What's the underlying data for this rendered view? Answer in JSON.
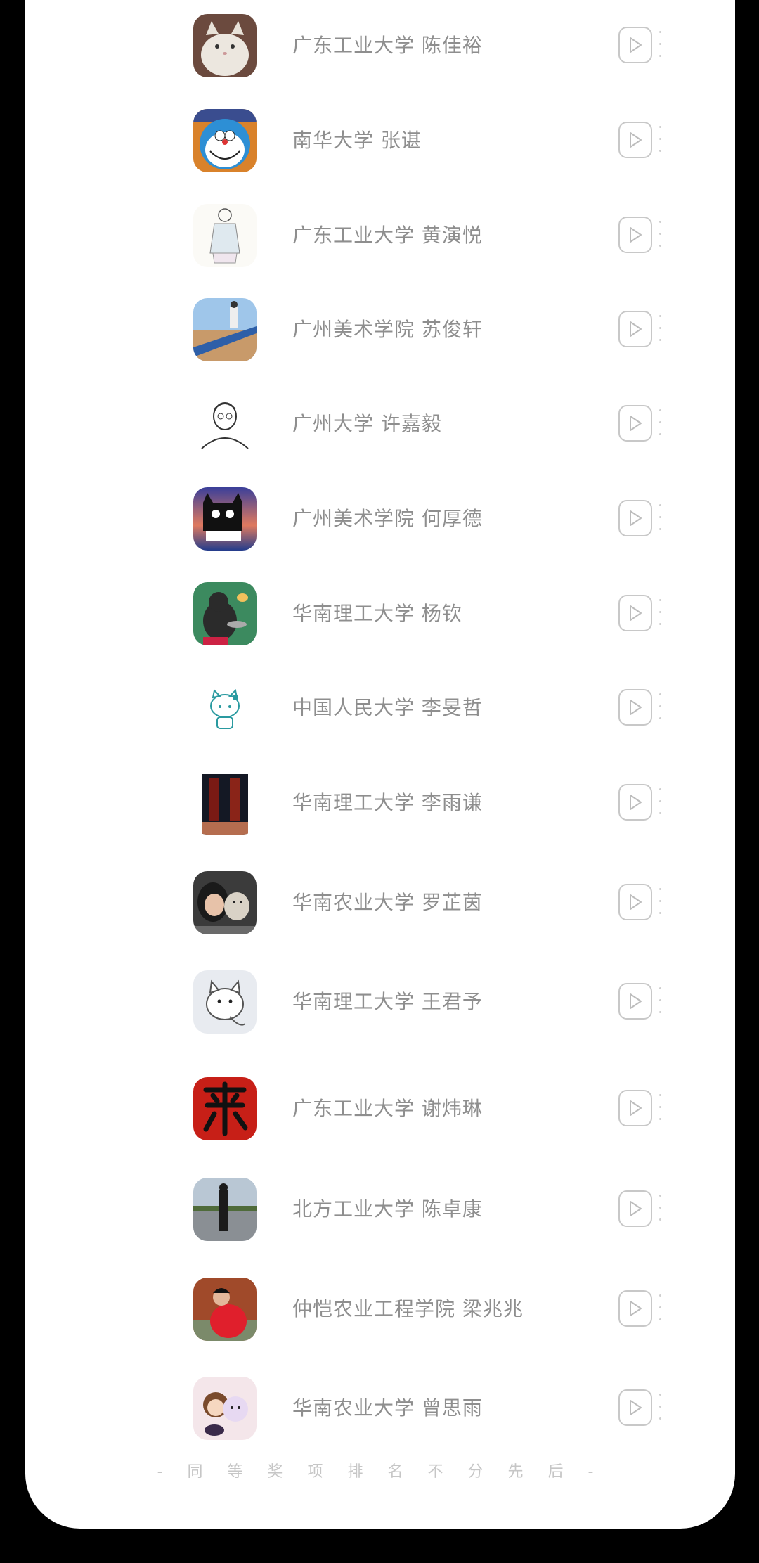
{
  "list": [
    {
      "name": "广东工业大学 陈佳裕",
      "avatar": "avatar-cat"
    },
    {
      "name": "南华大学 张谌",
      "avatar": "avatar-doraemon"
    },
    {
      "name": "广东工业大学 黄演悦",
      "avatar": "avatar-sketch-girl"
    },
    {
      "name": "广州美术学院 苏俊轩",
      "avatar": "avatar-pier"
    },
    {
      "name": "广州大学 许嘉毅",
      "avatar": "avatar-line-drawing"
    },
    {
      "name": "广州美术学院 何厚德",
      "avatar": "avatar-black-cat"
    },
    {
      "name": "华南理工大学 杨钦",
      "avatar": "avatar-cat-pan"
    },
    {
      "name": "中国人民大学 李旻哲",
      "avatar": "avatar-hello-kitty"
    },
    {
      "name": "华南理工大学 李雨谦",
      "avatar": "avatar-red-room"
    },
    {
      "name": "华南农业大学 罗芷茵",
      "avatar": "avatar-girl-dog"
    },
    {
      "name": "华南理工大学 王君予",
      "avatar": "avatar-cartoon-cat"
    },
    {
      "name": "广东工业大学 谢炜琳",
      "avatar": "avatar-yue-character"
    },
    {
      "name": "北方工业大学 陈卓康",
      "avatar": "avatar-standing-man"
    },
    {
      "name": "仲恺农业工程学院 梁兆兆",
      "avatar": "avatar-red-sweater"
    },
    {
      "name": "华南农业大学 曾思雨",
      "avatar": "avatar-cartoon-couple"
    }
  ],
  "footer": "- 同 等 奖 项 排 名 不 分 先 后 -",
  "colors": {
    "name_text": "#8e8e8e",
    "play_border": "#c8c8c8",
    "footer_text": "#c6c6c6",
    "card_bg": "#ffffff",
    "outer_bg": "#000000"
  }
}
